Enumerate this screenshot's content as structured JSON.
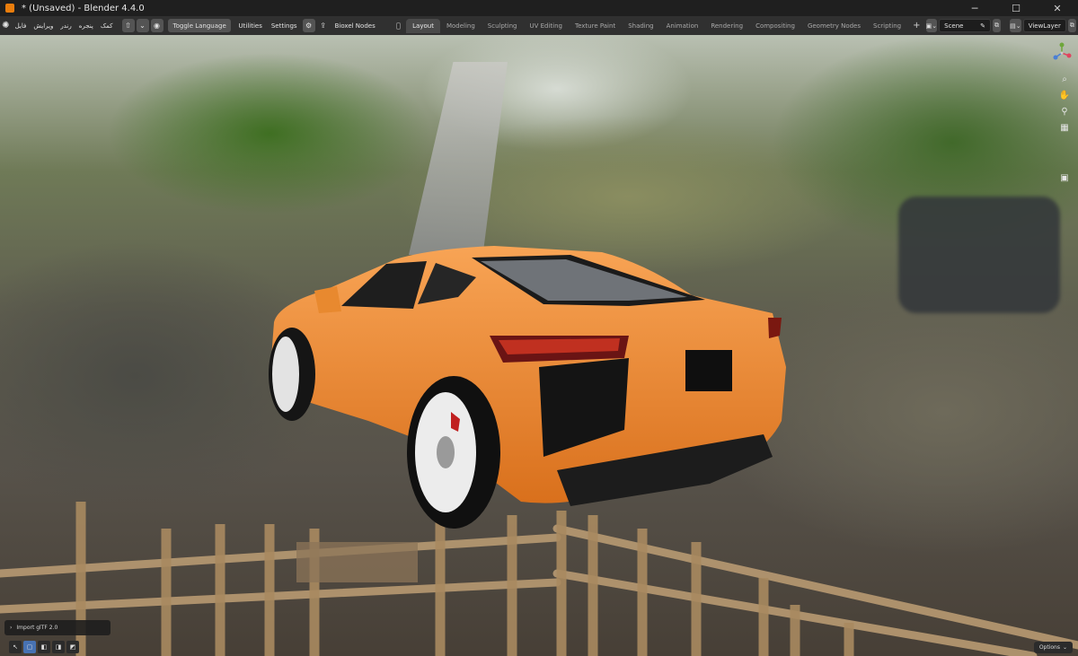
{
  "window": {
    "title": "* (Unsaved) - Blender 4.4.0",
    "controls": {
      "minimize": "─",
      "maximize": "☐",
      "close": "✕"
    }
  },
  "menu": [
    "فایل",
    "ویرایش",
    "رندر",
    "پنجره",
    "کمک"
  ],
  "toolbar": {
    "toggle_language": "Toggle Language",
    "utilities": "Utilities",
    "settings": "Settings",
    "bioxel_nodes": "Bioxel Nodes"
  },
  "workspace_tabs": [
    {
      "label": "Layout",
      "active": true
    },
    {
      "label": "Modeling",
      "active": false
    },
    {
      "label": "Sculpting",
      "active": false
    },
    {
      "label": "UV Editing",
      "active": false
    },
    {
      "label": "Texture Paint",
      "active": false
    },
    {
      "label": "Shading",
      "active": false
    },
    {
      "label": "Animation",
      "active": false
    },
    {
      "label": "Rendering",
      "active": false
    },
    {
      "label": "Compositing",
      "active": false
    },
    {
      "label": "Geometry Nodes",
      "active": false
    },
    {
      "label": "Scripting",
      "active": false
    }
  ],
  "scene": {
    "name": "Scene",
    "view_layer": "ViewLayer"
  },
  "operator_panel": {
    "label": "Import glTF 2.0"
  },
  "footer": {
    "options": "Options"
  },
  "colors": {
    "accent": "#4772b3",
    "car": "#f08a33",
    "brand": "#e87d0d"
  }
}
